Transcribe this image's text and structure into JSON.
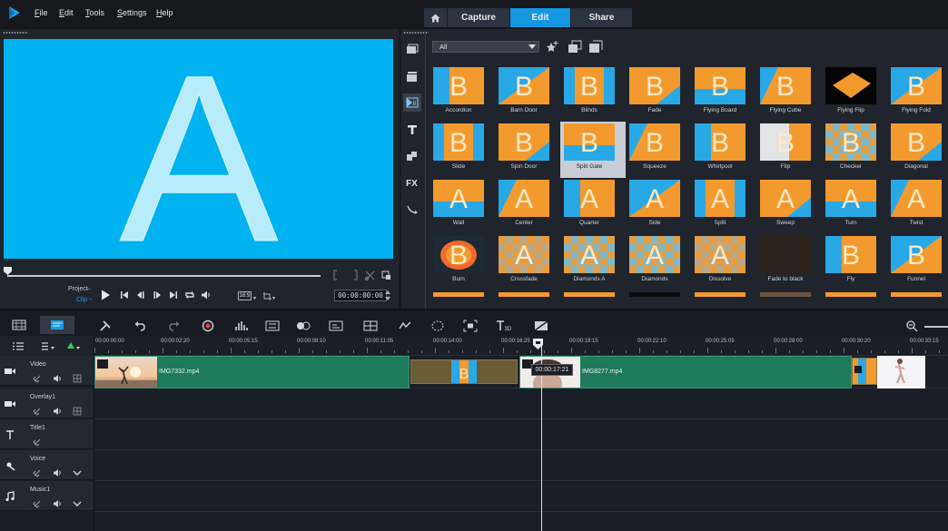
{
  "menu": [
    "File",
    "Edit",
    "Tools",
    "Settings",
    "Help"
  ],
  "tabs": {
    "home_icon": "home-icon",
    "capture": "Capture",
    "edit": "Edit",
    "share": "Share",
    "active": "edit"
  },
  "player": {
    "preview_letter": "A",
    "preview_bg": "#00b3f0",
    "project_label": "Project",
    "clip_label": "Clip",
    "aspect": "16:9",
    "timecode": "00:00:00:00",
    "controls": [
      "play-icon",
      "go-start-icon",
      "prev-frame-icon",
      "next-frame-icon",
      "go-end-icon",
      "repeat-icon",
      "volume-icon"
    ]
  },
  "library": {
    "category": "All",
    "sidebar_icons": [
      "media-icon",
      "instant-project-icon",
      "transition-icon",
      "title-icon",
      "graphics-icon",
      "fx-icon",
      "path-icon"
    ],
    "items": [
      "Accordion",
      "Barn Door",
      "Blinds",
      "Fade",
      "Flying Board",
      "Flying Cube",
      "Flying Flip",
      "Flying Fold",
      "Slide",
      "Spin Door",
      "Split Gate",
      "Squeeze",
      "Whirlpool",
      "Flip",
      "Checker",
      "Diagonal",
      "Wall",
      "Center",
      "Quarter",
      "Side",
      "Split",
      "Sweep",
      "Turn",
      "Twist",
      "Burn",
      "Crossfade",
      "Diamonds A",
      "Diamonds",
      "Dissolve",
      "Fade to black",
      "Fly",
      "Funnel"
    ],
    "selected": "Split Gate"
  },
  "timeline": {
    "ruler_ticks": [
      "00:00:00:00",
      "00:00:02:20",
      "00:00:05:15",
      "00:00:08:10",
      "00:00:11:05",
      "00:00:14:00",
      "00:00:16:25",
      "00:00:19:15",
      "00:00:22:10",
      "00:00:25:05",
      "00:00:28:00",
      "00:00:30:20",
      "00:00:33:15"
    ],
    "playhead_time": "00:00:17:21",
    "tracks": [
      "Video",
      "Overlay1",
      "Title1",
      "Voice",
      "Music1"
    ],
    "clips": [
      {
        "name": "IMG7332.mp4"
      },
      {
        "name": "IMG8277.mp4"
      }
    ],
    "colors": {
      "video_clip": "#1f7a5c",
      "transition": "#6a5c35",
      "accent": "#1596e0"
    }
  }
}
